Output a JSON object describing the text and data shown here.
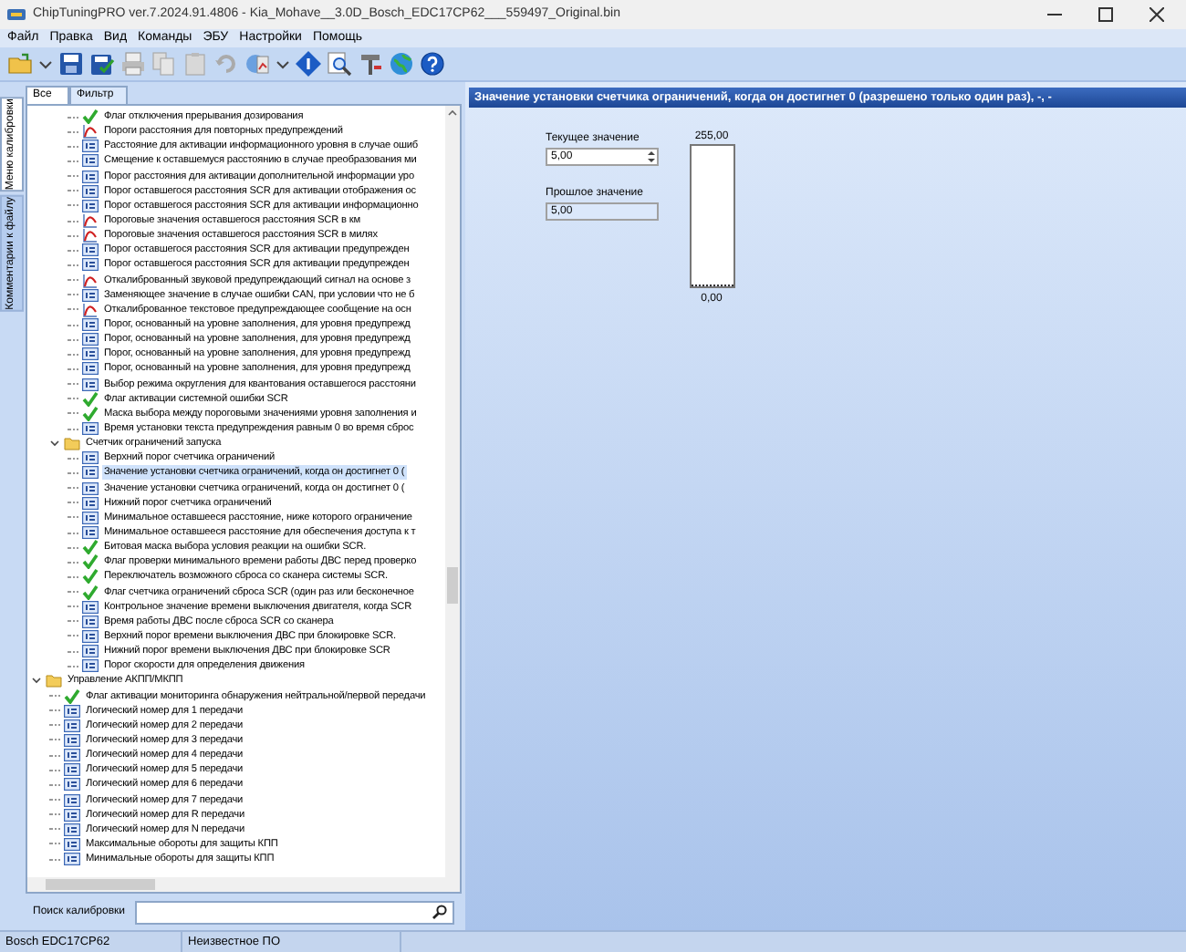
{
  "window": {
    "title": "ChipTuningPRO ver.7.2024.91.4806 - Kia_Mohave__3.0D_Bosch_EDC17CP62___559497_Original.bin"
  },
  "menu": [
    "Файл",
    "Правка",
    "Вид",
    "Команды",
    "ЭБУ",
    "Настройки",
    "Помощь"
  ],
  "side_tabs": [
    {
      "label": "Меню калибровки",
      "selected": true
    },
    {
      "label": "Комментарии к файлу",
      "selected": false
    }
  ],
  "filter_tabs": [
    {
      "label": "Все",
      "selected": true
    },
    {
      "label": "Фильтр",
      "selected": false
    }
  ],
  "tree": [
    {
      "children": [
        {
          "children": [
            {
              "kind": "flag",
              "label": "Флаг отключения прерывания дозирования"
            },
            {
              "kind": "curve",
              "label": "Пороги расстояния для повторных предупреждений"
            },
            {
              "kind": "value",
              "label": "Расстояние для активации информационного уровня в случае ошиб"
            },
            {
              "kind": "value",
              "label": "Смещение к оставшемуся расстоянию в случае преобразования ми"
            },
            {
              "kind": "value",
              "label": "Порог расстояния для активации дополнительной информации уро"
            },
            {
              "kind": "value",
              "label": "Порог оставшегося расстояния SCR для активации отображения ос"
            },
            {
              "kind": "value",
              "label": "Порог оставшегося расстояния SCR для активации информационно"
            },
            {
              "kind": "curve",
              "label": "Пороговые значения оставшегося расстояния SCR в км"
            },
            {
              "kind": "curve",
              "label": "Пороговые значения оставшегося расстояния SCR в милях"
            },
            {
              "kind": "value",
              "label": "Порог оставшегося расстояния SCR для активации предупрежден"
            },
            {
              "kind": "value",
              "label": "Порог оставшегося расстояния SCR для активации предупрежден"
            },
            {
              "kind": "curve",
              "label": "Откалиброванный звуковой предупреждающий сигнал на основе з"
            },
            {
              "kind": "value",
              "label": "Заменяющее значение в случае ошибки CAN, при условии что не б"
            },
            {
              "kind": "curve",
              "label": "Откалиброванное текстовое предупреждающее сообщение на осн"
            },
            {
              "kind": "value",
              "label": "Порог, основанный на уровне заполнения, для уровня предупрежд"
            },
            {
              "kind": "value",
              "label": "Порог, основанный на уровне заполнения, для уровня предупрежд"
            },
            {
              "kind": "value",
              "label": "Порог, основанный на уровне заполнения, для уровня предупрежд"
            },
            {
              "kind": "value",
              "label": "Порог, основанный на уровне заполнения, для уровня предупрежд"
            },
            {
              "kind": "value",
              "label": "Выбор режима округления для квантования оставшегося расстояни"
            },
            {
              "kind": "flag",
              "label": "Флаг активации системной ошибки SCR"
            },
            {
              "kind": "flag",
              "label": "Маска выбора между пороговыми значениями уровня заполнения и"
            },
            {
              "kind": "value",
              "label": "Время установки текста предупреждения равным 0 во время сброс"
            }
          ]
        },
        {
          "kind": "folder",
          "label": "Счетчик ограничений запуска",
          "expanded": true,
          "children": [
            {
              "kind": "value",
              "label": "Верхний порог счетчика ограничений"
            },
            {
              "kind": "value",
              "label": "Значение установки счетчика ограничений, когда он достигнет 0 (",
              "selected": true
            },
            {
              "kind": "value",
              "label": "Значение установки счетчика ограничений, когда он достигнет 0 ("
            },
            {
              "kind": "value",
              "label": "Нижний порог счетчика ограничений"
            },
            {
              "kind": "value",
              "label": "Минимальное оставшееся расстояние, ниже которого ограничение"
            },
            {
              "kind": "value",
              "label": "Минимальное оставшееся расстояние для обеспечения доступа к т"
            },
            {
              "kind": "flag",
              "label": "Битовая маска выбора условия реакции на ошибки SCR."
            },
            {
              "kind": "flag",
              "label": "Флаг проверки минимального времени работы ДВС перед проверко"
            },
            {
              "kind": "flag",
              "label": "Переключатель возможного сброса со сканера системы SCR."
            },
            {
              "kind": "flag",
              "label": "Флаг счетчика ограничений сброса SCR (один раз или бесконечное"
            },
            {
              "kind": "value",
              "label": "Контрольное значение времени выключения двигателя, когда SCR"
            },
            {
              "kind": "value",
              "label": "Время работы ДВС после сброса SCR со сканера"
            },
            {
              "kind": "value",
              "label": "Верхний порог времени выключения ДВС при блокировке SCR."
            },
            {
              "kind": "value",
              "label": "Нижний порог времени выключения ДВС при блокировке SCR"
            },
            {
              "kind": "value",
              "label": "Порог скорости для определения движения"
            }
          ]
        }
      ]
    },
    {
      "kind": "folder",
      "label": "Управление АКПП/МКПП",
      "expanded": true,
      "children": [
        {
          "kind": "flag",
          "label": "Флаг активации мониторинга обнаружения нейтральной/первой передачи"
        },
        {
          "kind": "value",
          "label": "Логический номер для 1 передачи"
        },
        {
          "kind": "value",
          "label": "Логический номер для 2 передачи"
        },
        {
          "kind": "value",
          "label": "Логический номер для 3 передачи"
        },
        {
          "kind": "value",
          "label": "Логический номер для 4 передачи"
        },
        {
          "kind": "value",
          "label": "Логический номер для 5 передачи"
        },
        {
          "kind": "value",
          "label": "Логический номер для 6 передачи"
        },
        {
          "kind": "value",
          "label": "Логический номер для 7 передачи"
        },
        {
          "kind": "value",
          "label": "Логический номер для R передачи"
        },
        {
          "kind": "value",
          "label": "Логический номер для N передачи"
        },
        {
          "kind": "value",
          "label": "Максимальные обороты для защиты КПП"
        },
        {
          "kind": "value",
          "label": "Минимальные обороты для защиты КПП"
        }
      ]
    }
  ],
  "search": {
    "label": "Поиск калибровки"
  },
  "editor": {
    "title": "Значение установки счетчика ограничений, когда он достигнет 0 (разрешено только один раз), -, -",
    "current_label": "Текущее значение",
    "current_value": "5,00",
    "previous_label": "Прошлое значение",
    "previous_value": "5,00",
    "bar_max": "255,00",
    "bar_min": "0,00",
    "level": 0.0196
  },
  "status_bar": [
    "Bosch EDC17CP62",
    "Неизвестное ПО"
  ]
}
